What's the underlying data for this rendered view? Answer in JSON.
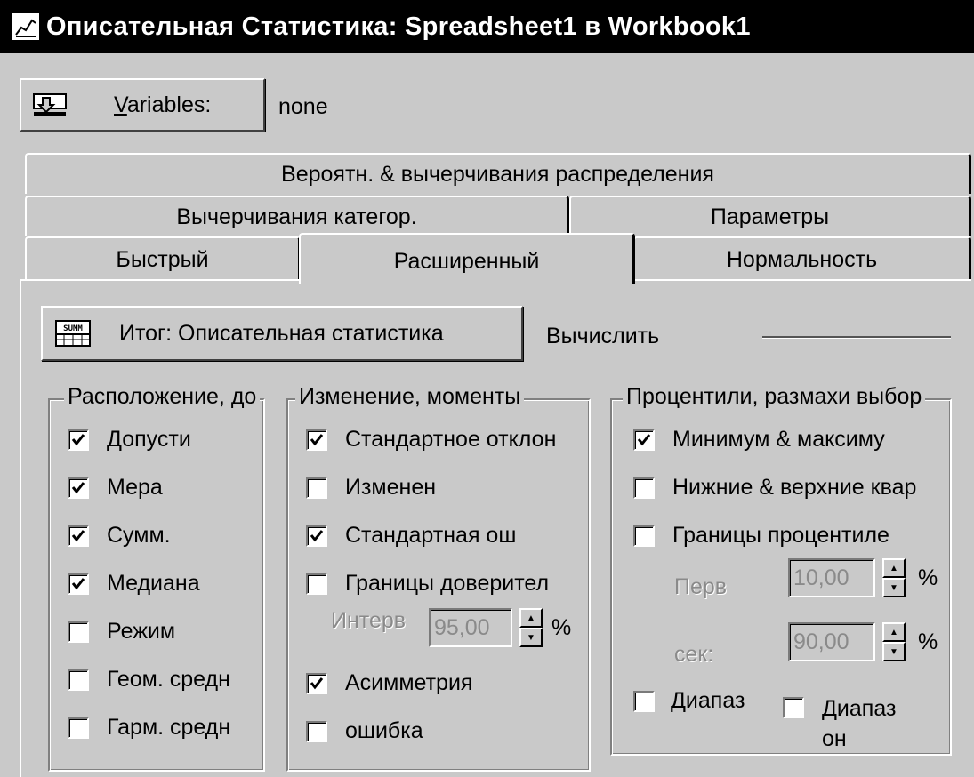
{
  "window": {
    "title": "Описательная Статистика: Spreadsheet1 в Workbook1",
    "icon": "chart-icon"
  },
  "variables": {
    "button_label_underlined": "V",
    "button_label_rest": "ariables:",
    "value": "none"
  },
  "tabs": {
    "row1": [
      {
        "label": "Вероятн. & вычерчивания распределения"
      }
    ],
    "row2": [
      {
        "label": "Вычерчивания категор."
      },
      {
        "label": "Параметры"
      }
    ],
    "row3": [
      {
        "label": "Быстрый"
      },
      {
        "label": "Расширенный"
      },
      {
        "label": "Нормальность"
      }
    ],
    "active": "Расширенный"
  },
  "summary": {
    "button_label": "Итог: Описательная статистика",
    "calc_label": "Вычислить"
  },
  "groups": {
    "location": {
      "title": "Расположение, до",
      "items": [
        {
          "label": "Допусти",
          "checked": true
        },
        {
          "label": "Мера",
          "checked": true
        },
        {
          "label": "Сумм.",
          "checked": true
        },
        {
          "label": "Медиана",
          "checked": true
        },
        {
          "label": "Режим",
          "checked": false
        },
        {
          "label": "Геом. средн",
          "checked": false
        },
        {
          "label": "Гарм. средн",
          "checked": false
        }
      ]
    },
    "variation": {
      "title": "Изменение, моменты",
      "items": [
        {
          "label": "Стандартное отклон",
          "checked": true
        },
        {
          "label": "Изменен",
          "checked": false
        },
        {
          "label": "Стандартная ош",
          "checked": true
        },
        {
          "label": "Границы доверител",
          "checked": false
        }
      ],
      "interval_label": "Интерв",
      "interval_value": "95,00",
      "interval_unit": "%",
      "items2": [
        {
          "label": "Асимметрия",
          "checked": true
        },
        {
          "label": "ошибка",
          "checked": false
        }
      ]
    },
    "percentiles": {
      "title": "Процентили, размахи выбор",
      "items": [
        {
          "label": "Минимум & максиму",
          "checked": true
        },
        {
          "label": "Нижние & верхние квар",
          "checked": false
        },
        {
          "label": "Границы процентиле",
          "checked": false
        }
      ],
      "first_label": "Перв",
      "first_value": "10,00",
      "second_label": "сек:",
      "second_value": "90,00",
      "unit": "%",
      "range1_label": "Диапаз",
      "range1_checked": false,
      "range2_label": "Диапаз",
      "range2_label2": "он",
      "range2_checked": false
    }
  }
}
